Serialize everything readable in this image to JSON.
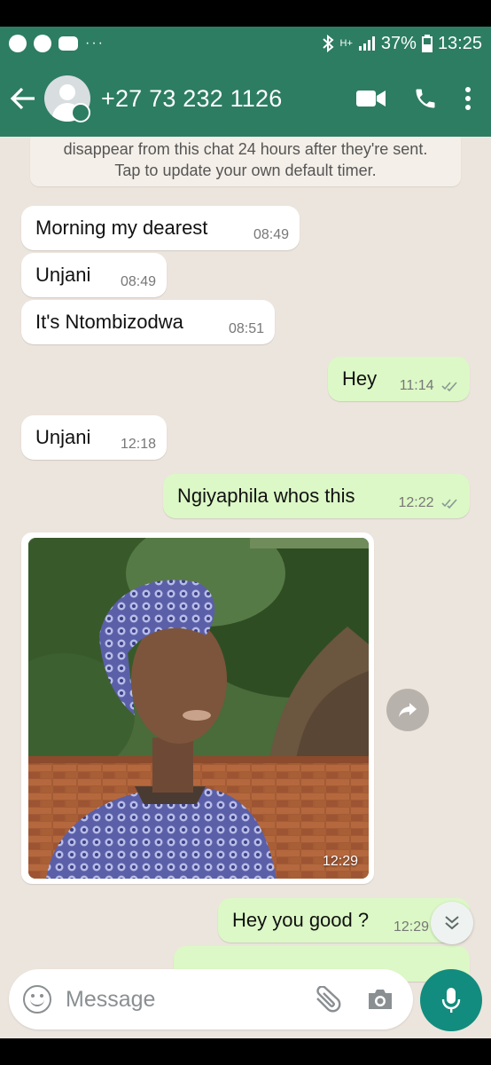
{
  "status_bar": {
    "battery": "37%",
    "time": "13:25",
    "left_icons": [
      "tiktok-icon",
      "facebook-icon",
      "youtube-icon"
    ],
    "more": "···",
    "network": "H+"
  },
  "header": {
    "contact_name": "+27 73 232 1126",
    "icons": [
      "back-arrow-icon",
      "avatar",
      "video-call-icon",
      "phone-call-icon",
      "more-vert-icon"
    ]
  },
  "notice": {
    "line1": "disappear from this chat 24 hours after they're sent.",
    "line2": "Tap to update your own default timer."
  },
  "messages": [
    {
      "dir": "in",
      "text": "Morning my dearest",
      "time": "08:49"
    },
    {
      "dir": "in",
      "text": "Unjani",
      "time": "08:49"
    },
    {
      "dir": "in",
      "text": "It's Ntombizodwa",
      "time": "08:51"
    },
    {
      "dir": "out",
      "text": "Hey",
      "time": "11:14"
    },
    {
      "dir": "in",
      "text": "Unjani",
      "time": "12:18"
    },
    {
      "dir": "out",
      "text": "Ngiyaphila whos this",
      "time": "12:22"
    },
    {
      "dir": "in",
      "type": "image",
      "time": "12:29"
    },
    {
      "dir": "out",
      "text": "Hey you good ?",
      "time": "12:29"
    }
  ],
  "composer": {
    "placeholder": "Message"
  },
  "colors": {
    "header": "#2d7d62",
    "chat_bg": "#ece5dd",
    "outgoing": "#dcf8c6",
    "incoming": "#ffffff",
    "mic": "#128c7e"
  }
}
